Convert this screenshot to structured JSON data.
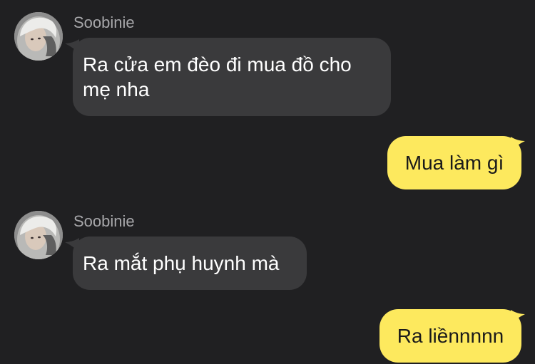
{
  "colors": {
    "background": "#202022",
    "incoming_bubble": "#3a3a3c",
    "outgoing_bubble": "#fde95e",
    "sender_name": "#a7a7aa"
  },
  "messages": [
    {
      "direction": "incoming",
      "sender": "Soobinie",
      "avatar": "profile-avatar",
      "text": "Ra cửa em đèo đi mua đồ cho mẹ nha"
    },
    {
      "direction": "outgoing",
      "text": "Mua làm gì"
    },
    {
      "direction": "incoming",
      "sender": "Soobinie",
      "avatar": "profile-avatar",
      "text": "Ra mắt phụ huynh mà"
    },
    {
      "direction": "outgoing",
      "text": "Ra liềnnnnn"
    }
  ]
}
